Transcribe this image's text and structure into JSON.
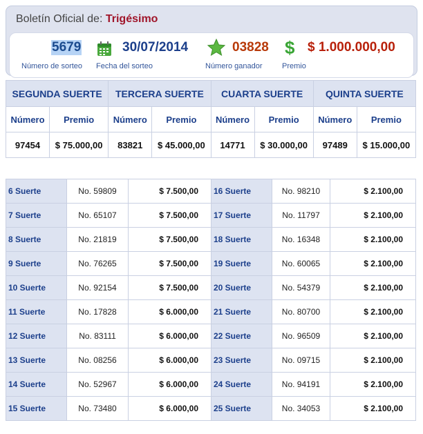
{
  "header": {
    "title_prefix": "Boletín Oficial de:",
    "title_highlight": "Trigésimo",
    "sorteo_number": "5679",
    "sorteo_label": "Número de sorteo",
    "date": "30/07/2014",
    "date_label": "Fecha del sorteo",
    "winning_number": "03828",
    "winning_label": "Número ganador",
    "prize": "$ 1.000.000,00",
    "prize_label": "Premio"
  },
  "suertes": {
    "headers": [
      "SEGUNDA SUERTE",
      "TERCERA SUERTE",
      "CUARTA SUERTE",
      "QUINTA SUERTE"
    ],
    "col_numero": "Número",
    "col_premio": "Premio",
    "rows": [
      {
        "numero": "97454",
        "premio": "$ 75.000,00"
      },
      {
        "numero": "83821",
        "premio": "$ 45.000,00"
      },
      {
        "numero": "14771",
        "premio": "$ 30.000,00"
      },
      {
        "numero": "97489",
        "premio": "$ 15.000,00"
      }
    ]
  },
  "lower": [
    {
      "l1": "6 Suerte",
      "n1": "No. 59809",
      "a1": "$ 7.500,00",
      "l2": "16 Suerte",
      "n2": "No. 98210",
      "a2": "$ 2.100,00"
    },
    {
      "l1": "7 Suerte",
      "n1": "No. 65107",
      "a1": "$ 7.500,00",
      "l2": "17 Suerte",
      "n2": "No. 11797",
      "a2": "$ 2.100,00"
    },
    {
      "l1": "8 Suerte",
      "n1": "No. 21819",
      "a1": "$ 7.500,00",
      "l2": "18 Suerte",
      "n2": "No. 16348",
      "a2": "$ 2.100,00"
    },
    {
      "l1": "9 Suerte",
      "n1": "No. 76265",
      "a1": "$ 7.500,00",
      "l2": "19 Suerte",
      "n2": "No. 60065",
      "a2": "$ 2.100,00"
    },
    {
      "l1": "10 Suerte",
      "n1": "No. 92154",
      "a1": "$ 7.500,00",
      "l2": "20 Suerte",
      "n2": "No. 54379",
      "a2": "$ 2.100,00"
    },
    {
      "l1": "11 Suerte",
      "n1": "No. 17828",
      "a1": "$ 6.000,00",
      "l2": "21 Suerte",
      "n2": "No. 80700",
      "a2": "$ 2.100,00"
    },
    {
      "l1": "12 Suerte",
      "n1": "No. 83111",
      "a1": "$ 6.000,00",
      "l2": "22 Suerte",
      "n2": "No. 96509",
      "a2": "$ 2.100,00"
    },
    {
      "l1": "13 Suerte",
      "n1": "No. 08256",
      "a1": "$ 6.000,00",
      "l2": "23 Suerte",
      "n2": "No. 09715",
      "a2": "$ 2.100,00"
    },
    {
      "l1": "14 Suerte",
      "n1": "No. 52967",
      "a1": "$ 6.000,00",
      "l2": "24 Suerte",
      "n2": "No. 94191",
      "a2": "$ 2.100,00"
    },
    {
      "l1": "15 Suerte",
      "n1": "No. 73480",
      "a1": "$ 6.000,00",
      "l2": "25 Suerte",
      "n2": "No. 34053",
      "a2": "$ 2.100,00"
    }
  ],
  "colors": {
    "title_highlight": "#a0152a",
    "sorteo": "#1b4b8f",
    "date": "#1c3f8b",
    "winning": "#b83a0a",
    "prize": "#b8200a",
    "header_bg": "#dde3f1",
    "accent_text": "#1c3f8b"
  },
  "icons": {
    "date": "calendar-icon",
    "winning": "star-icon",
    "prize": "dollar-icon"
  }
}
